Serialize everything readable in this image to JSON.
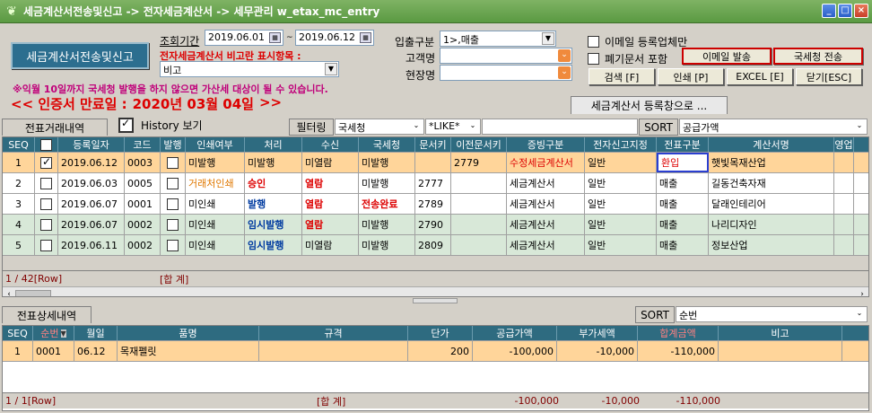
{
  "window": {
    "title": "세금계산서전송및신고 -> 전자세금계산서 -> 세무관리 w_etax_mc_entry",
    "minimize": "_",
    "maximize": "□",
    "close": "×"
  },
  "main_button": "세금계산서전송및신고",
  "filters": {
    "period_label": "조회기간",
    "date_from": "2019.06.01",
    "date_sep": "~",
    "date_to": "2019.06.12",
    "remark_label": "전자세금계산서 비고란 표시항목 :",
    "remark_value": "비고",
    "io_label": "입출구분",
    "io_value": "1>,매출",
    "customer_label": "고객명",
    "customer_value": "",
    "site_label": "현장명",
    "site_value": ""
  },
  "notice": "※익월 10일까지 국세청 발행을 하지 않으면 가산세 대상이 될 수 있습니다.",
  "cert": {
    "prefix": "<< 인증서 만료일 :",
    "date": "2020년 03월 04일",
    "suffix": ">>"
  },
  "options": {
    "email_only": "이메일 등록업체만",
    "closed_docs": "폐기문서 포함",
    "email_send": "이메일 발송",
    "nts_send": "국세청 전송"
  },
  "buttons": {
    "search": "검색 [F]",
    "print": "인쇄 [P]",
    "excel": "EXCEL [E]",
    "close": "닫기[ESC]"
  },
  "register_tab": "세금계산서 등록창으로 ...",
  "top": {
    "tab": "전표거래내역",
    "history": "History 보기",
    "filter_label": "필터링",
    "filter_field": "국세청",
    "filter_op": "*LIKE*",
    "filter_value": "",
    "sort_label": "SORT",
    "sort_value": "공급가액",
    "columns": [
      "SEQ",
      "",
      "등록일자",
      "코드",
      "발행",
      "인쇄여부",
      "처리",
      "수신",
      "국세청",
      "문서키",
      "이전문서키",
      "증빙구분",
      "전자신고지정",
      "전표구분",
      "계산서명",
      "영업"
    ],
    "rows": [
      {
        "seq": "1",
        "checked": true,
        "date": "2019.06.12",
        "code": "0003",
        "print": "미발행",
        "proc": "미발행",
        "recv": "미열람",
        "nts": "미발행",
        "dockey": "",
        "prevkey": "2779",
        "type": "수정세금계산서",
        "edecl": "일반",
        "slip": "환입",
        "name": "햇빛목재산업"
      },
      {
        "seq": "2",
        "checked": false,
        "date": "2019.06.03",
        "code": "0005",
        "print": "거래처인쇄",
        "proc": "승인",
        "recv": "열람",
        "nts": "미발행",
        "dockey": "2777",
        "prevkey": "",
        "type": "세금계산서",
        "edecl": "일반",
        "slip": "매출",
        "name": "길동건축자재"
      },
      {
        "seq": "3",
        "checked": false,
        "date": "2019.06.07",
        "code": "0001",
        "print": "미인쇄",
        "proc": "발행",
        "recv": "열람",
        "nts": "전송완료",
        "dockey": "2789",
        "prevkey": "",
        "type": "세금계산서",
        "edecl": "일반",
        "slip": "매출",
        "name": "달래인테리어"
      },
      {
        "seq": "4",
        "checked": false,
        "date": "2019.06.07",
        "code": "0002",
        "print": "미인쇄",
        "proc": "임시발행",
        "recv": "열람",
        "nts": "미발행",
        "dockey": "2790",
        "prevkey": "",
        "type": "세금계산서",
        "edecl": "일반",
        "slip": "매출",
        "name": "나리디자인"
      },
      {
        "seq": "5",
        "checked": false,
        "date": "2019.06.11",
        "code": "0002",
        "print": "미인쇄",
        "proc": "임시발행",
        "recv": "미열람",
        "nts": "미발행",
        "dockey": "2809",
        "prevkey": "",
        "type": "세금계산서",
        "edecl": "일반",
        "slip": "매출",
        "name": "정보산업"
      }
    ],
    "footer_count": "1 / 42[Row]",
    "footer_sum": "[합 계]"
  },
  "bottom": {
    "tab": "전표상세내역",
    "sort_label": "SORT",
    "sort_value": "순번",
    "columns": [
      "SEQ",
      "순번",
      "월일",
      "품명",
      "규격",
      "단가",
      "공급가액",
      "부가세액",
      "합계금액",
      "비고"
    ],
    "rows": [
      {
        "seq": "1",
        "no": "0001",
        "md": "06.12",
        "item": "목재펠릿",
        "spec": "",
        "price": "200",
        "supply": "-100,000",
        "vat": "-10,000",
        "total": "-110,000",
        "note": ""
      }
    ],
    "footer_count": "1 / 1[Row]",
    "footer_sum": "[합 계]",
    "sum_supply": "-100,000",
    "sum_vat": "-10,000",
    "sum_total": "-110,000"
  }
}
